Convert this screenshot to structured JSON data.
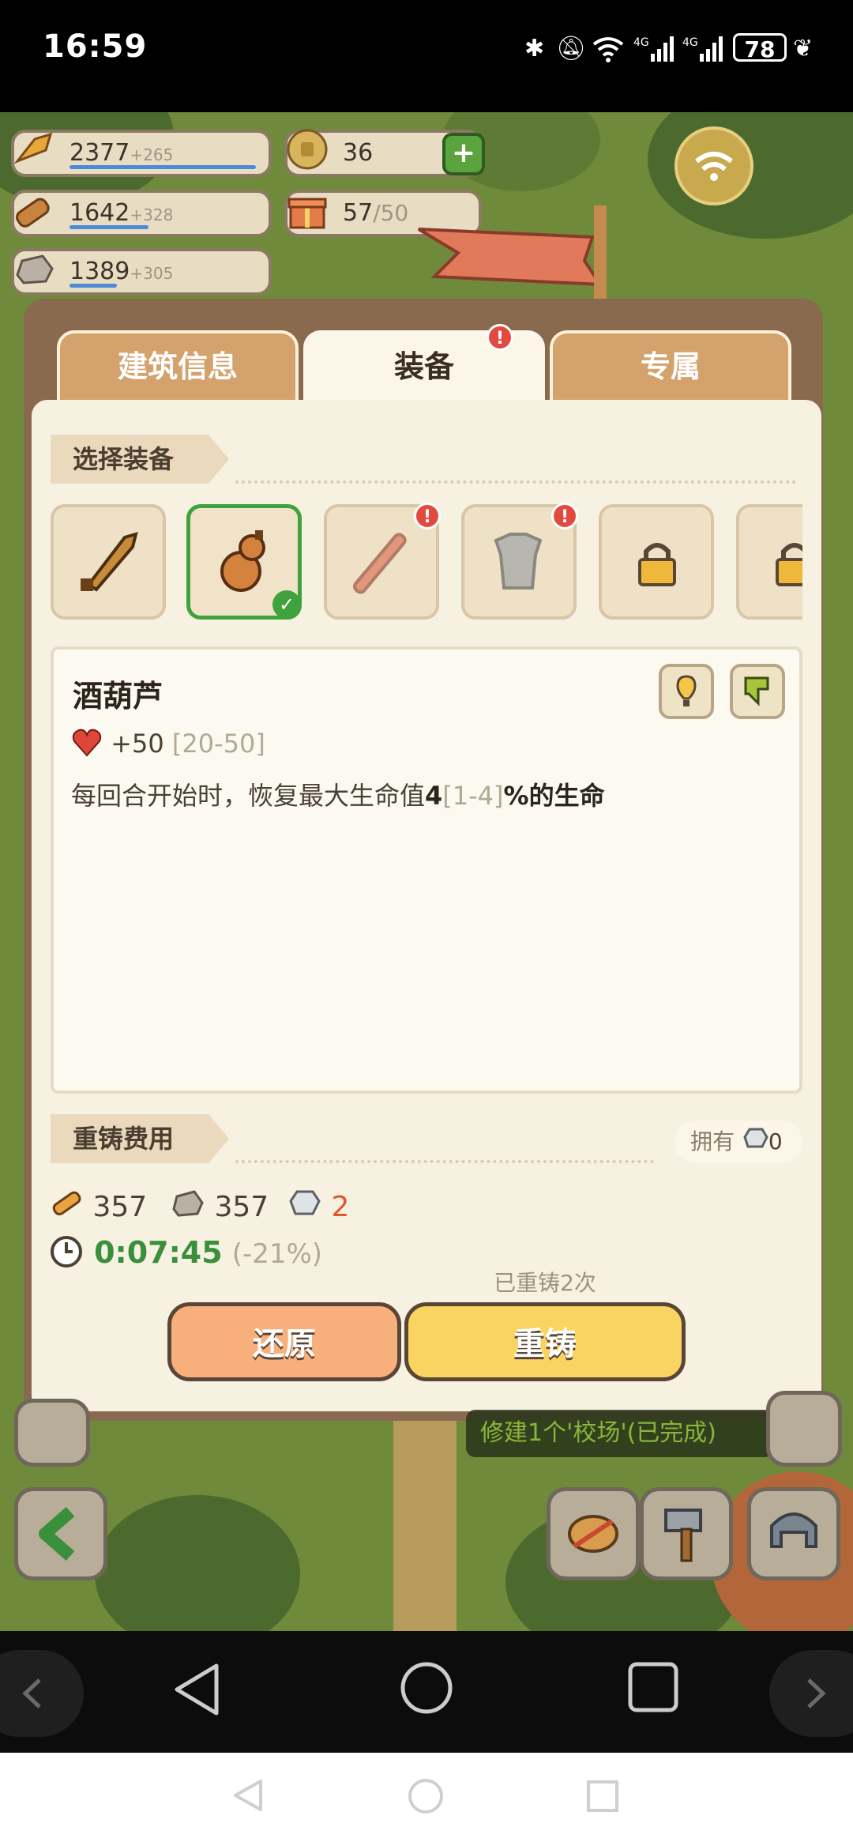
{
  "status_bar": {
    "time": "16:59",
    "battery": "78",
    "icons": [
      "bluetooth-icon",
      "mute-icon",
      "wifi-icon",
      "4g-signal-icon",
      "4g-signal-icon",
      "battery-icon",
      "leaf-icon"
    ]
  },
  "resources": [
    {
      "icon": "wheat-icon",
      "value": "2377",
      "plus": "+265"
    },
    {
      "icon": "wood-icon",
      "value": "1642",
      "plus": "+328"
    },
    {
      "icon": "stone-icon",
      "value": "1389",
      "plus": "+305"
    }
  ],
  "currencies": {
    "coins": "36",
    "gift_current": "57",
    "gift_max": "/50"
  },
  "modal": {
    "tabs": [
      {
        "label": "建筑信息",
        "active": false
      },
      {
        "label": "装备",
        "active": true,
        "badge": "!"
      },
      {
        "label": "专属",
        "active": false
      }
    ],
    "select_section_label": "选择装备",
    "equipment_slots": [
      {
        "icon": "sword-icon",
        "state": "normal"
      },
      {
        "icon": "gourd-icon",
        "state": "selected"
      },
      {
        "icon": "staff-icon",
        "state": "alert"
      },
      {
        "icon": "armor-icon",
        "state": "alert"
      },
      {
        "icon": "lock-icon",
        "state": "locked"
      },
      {
        "icon": "lock-icon",
        "state": "locked"
      }
    ],
    "detail": {
      "name": "酒葫芦",
      "stat_value": "+50",
      "stat_range": "[20-50]",
      "effect_prefix": "每回合开始时，恢复最大生命值",
      "effect_value": "4",
      "effect_range": "[1-4]",
      "effect_suffix": "%的生命"
    },
    "reforge_section_label": "重铸费用",
    "owned_label": "拥有",
    "owned_value": "0",
    "costs": [
      {
        "icon": "wood-icon",
        "value": "357"
      },
      {
        "icon": "stone-icon",
        "value": "357"
      },
      {
        "icon": "crystal-icon",
        "value": "2"
      }
    ],
    "timer": "0:07:45",
    "timer_discount": "(-21%)",
    "reforged_count": "已重铸2次",
    "restore_label": "还原",
    "reforge_label": "重铸"
  },
  "quest_text": "修建1个'校场'(已完成)",
  "colors": {
    "accent_green": "#3fa23d",
    "reforge_yellow": "#fad461",
    "restore_orange": "#f7b07b",
    "alert_red": "#e34a3f"
  }
}
